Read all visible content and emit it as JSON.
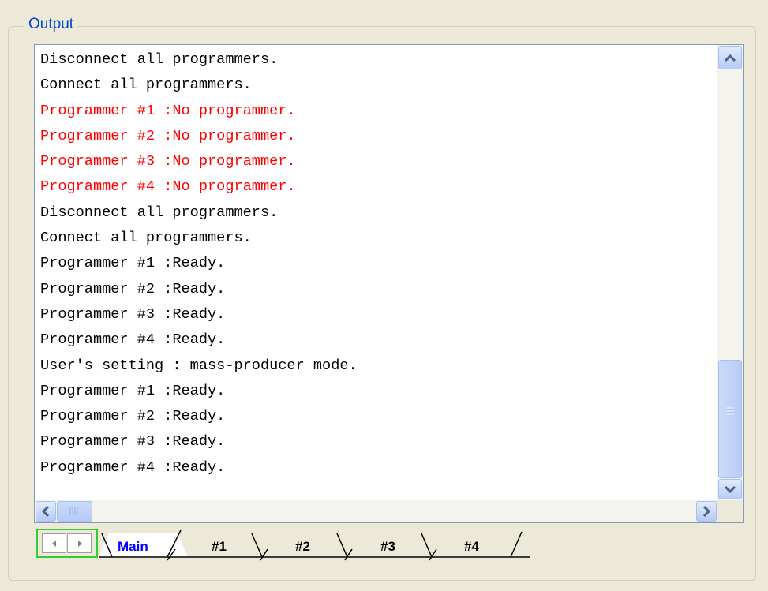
{
  "panel": {
    "title": "Output"
  },
  "log": [
    {
      "text": "Disconnect all programmers.",
      "color": "#000000"
    },
    {
      "text": "Connect all programmers.",
      "color": "#000000"
    },
    {
      "text": "Programmer #1 :No programmer.",
      "color": "#ff0000"
    },
    {
      "text": "Programmer #2 :No programmer.",
      "color": "#ff0000"
    },
    {
      "text": "Programmer #3 :No programmer.",
      "color": "#ff0000"
    },
    {
      "text": "Programmer #4 :No programmer.",
      "color": "#ff0000"
    },
    {
      "text": "Disconnect all programmers.",
      "color": "#000000"
    },
    {
      "text": "Connect all programmers.",
      "color": "#000000"
    },
    {
      "text": "Programmer #1 :Ready.",
      "color": "#000000"
    },
    {
      "text": "Programmer #2 :Ready.",
      "color": "#000000"
    },
    {
      "text": "Programmer #3 :Ready.",
      "color": "#000000"
    },
    {
      "text": "Programmer #4 :Ready.",
      "color": "#000000"
    },
    {
      "text": "User's setting : mass-producer mode.",
      "color": "#000000"
    },
    {
      "text": "Programmer #1 :Ready.",
      "color": "#000000"
    },
    {
      "text": "Programmer #2 :Ready.",
      "color": "#000000"
    },
    {
      "text": "Programmer #3 :Ready.",
      "color": "#000000"
    },
    {
      "text": "Programmer #4 :Ready.",
      "color": "#000000"
    }
  ],
  "scrollbars": {
    "vertical_position": "bottom",
    "horizontal_position": "left"
  },
  "tabs": {
    "active": "Main",
    "items": [
      {
        "label": "Main",
        "active": true
      },
      {
        "label": "#1",
        "active": false
      },
      {
        "label": "#2",
        "active": false
      },
      {
        "label": "#3",
        "active": false
      },
      {
        "label": "#4",
        "active": false
      }
    ]
  },
  "colors": {
    "active_tab_text": "#0000ff",
    "error_text": "#ff0000",
    "group_title": "#0046d5",
    "nav_focus_border": "#33cc33"
  }
}
